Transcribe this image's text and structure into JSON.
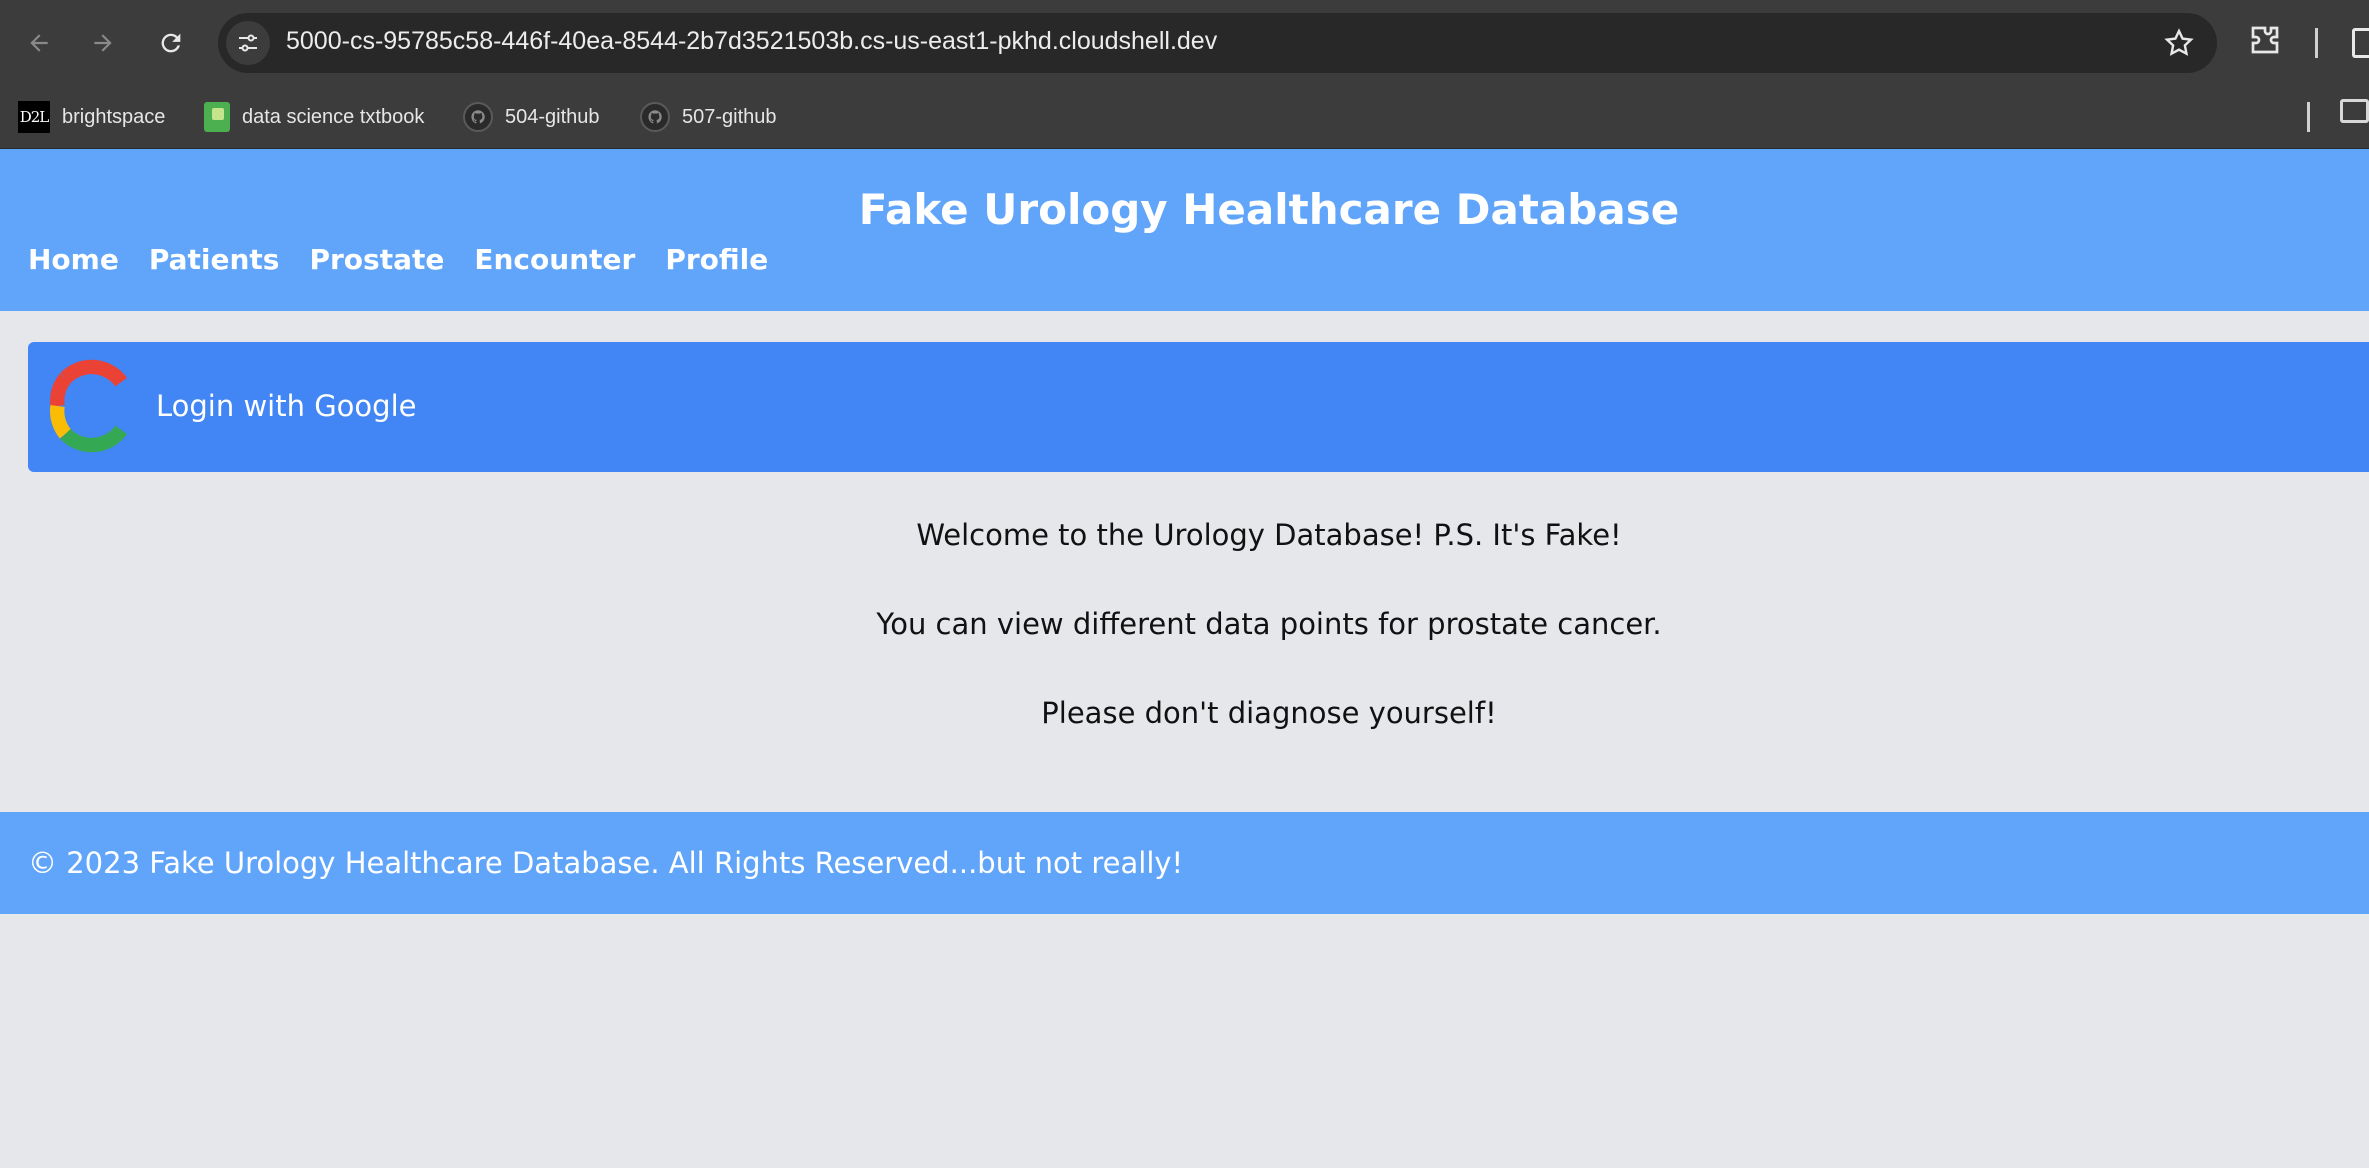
{
  "browser": {
    "url": "5000-cs-95785c58-446f-40ea-8544-2b7d3521503b.cs-us-east1-pkhd.cloudshell.dev",
    "bookmarks": [
      {
        "label": "brightspace",
        "icon": "d2l-icon",
        "icon_text": "D2L"
      },
      {
        "label": "data science txtbook",
        "icon": "book-icon"
      },
      {
        "label": "504-github",
        "icon": "github-icon"
      },
      {
        "label": "507-github",
        "icon": "github-icon"
      }
    ]
  },
  "site": {
    "title": "Fake Urology Healthcare Database",
    "nav": [
      "Home",
      "Patients",
      "Prostate",
      "Encounter",
      "Profile"
    ],
    "login_label": "Login with Google",
    "welcome": [
      "Welcome to the Urology Database! P.S. It's Fake!",
      "You can view different data points for prostate cancer.",
      "Please don't diagnose yourself!"
    ],
    "footer": "© 2023 Fake Urology Healthcare Database. All Rights Reserved...but not really!"
  },
  "colors": {
    "header": "#60a5fa",
    "login_button": "#4285f4",
    "page_background": "#e5e7eb"
  }
}
